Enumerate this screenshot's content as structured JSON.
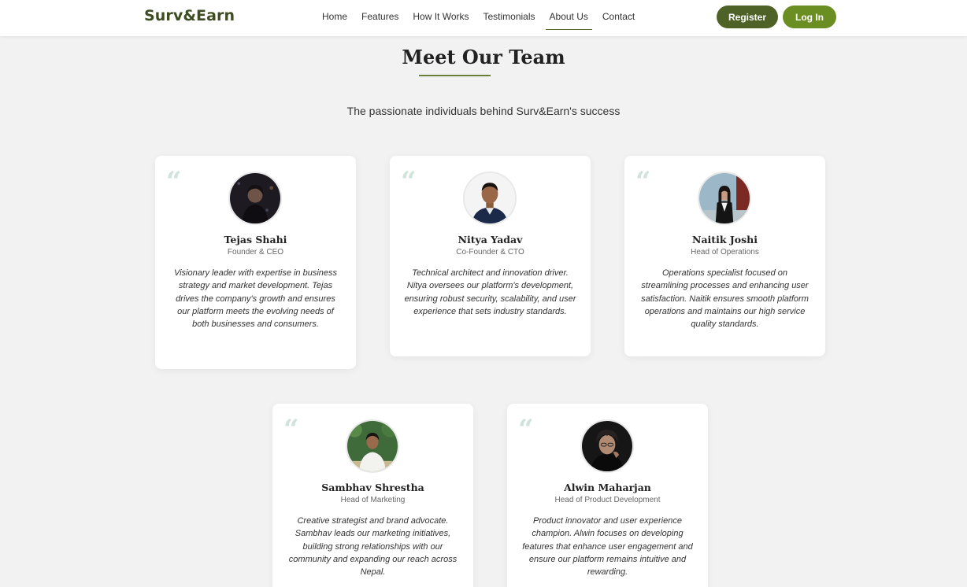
{
  "brand": {
    "logo": "Surv&Earn"
  },
  "nav": {
    "links": [
      "Home",
      "Features",
      "How It Works",
      "Testimonials",
      "About Us",
      "Contact"
    ],
    "active": "About Us",
    "register_label": "Register",
    "login_label": "Log In"
  },
  "section": {
    "title": "Meet Our Team",
    "subtitle": "The passionate individuals behind Surv&Earn's success"
  },
  "team": [
    {
      "name": "Tejas Shahi",
      "role": "Founder & CEO",
      "bio": "Visionary leader with expertise in business strategy and market development. Tejas drives the company's growth and ensures our platform meets the evolving needs of both businesses and consumers."
    },
    {
      "name": "Nitya Yadav",
      "role": "Co-Founder & CTO",
      "bio": "Technical architect and innovation driver. Nitya oversees our platform's development, ensuring robust security, scalability, and user experience that sets industry standards."
    },
    {
      "name": "Naitik Joshi",
      "role": "Head of Operations",
      "bio": "Operations specialist focused on streamlining processes and enhancing user satisfaction. Naitik ensures smooth platform operations and maintains our high service quality standards."
    },
    {
      "name": "Sambhav Shrestha",
      "role": "Head of Marketing",
      "bio": "Creative strategist and brand advocate. Sambhav leads our marketing initiatives, building strong relationships with our community and expanding our reach across Nepal."
    },
    {
      "name": "Alwin Maharjan",
      "role": "Head of Product Development",
      "bio": "Product innovator and user experience champion. Alwin focuses on developing features that enhance user engagement and ensure our platform remains intuitive and rewarding."
    }
  ],
  "quote_glyph": "“",
  "colors": {
    "brand_dark": "#3d4d21",
    "register_bg": "#4e6228",
    "login_bg": "#6b8e23",
    "accent_underline": "#6b7d3a",
    "quote_mark": "#cfe3db"
  }
}
